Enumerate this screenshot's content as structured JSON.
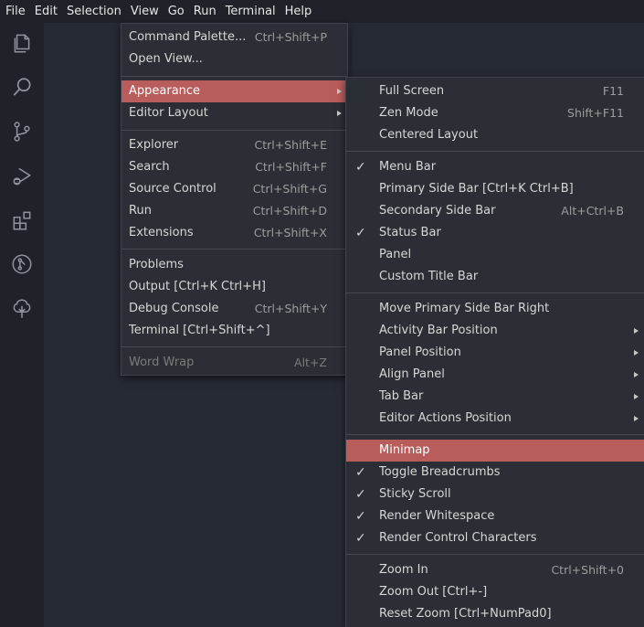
{
  "menubar": [
    "File",
    "Edit",
    "Selection",
    "View",
    "Go",
    "Run",
    "Terminal",
    "Help"
  ],
  "activity_icons": [
    "explorer-icon",
    "search-icon",
    "source-control-icon",
    "run-debug-icon",
    "extensions-icon",
    "remote-explorer-icon",
    "tree-icon"
  ],
  "view_menu": {
    "items": [
      {
        "label": "Command Palette...",
        "key": "Ctrl+Shift+P"
      },
      {
        "label": "Open View...",
        "key": ""
      },
      {
        "label": "Appearance",
        "key": "",
        "submenu": true,
        "selected": true
      },
      {
        "label": "Editor Layout",
        "key": "",
        "submenu": true
      },
      {
        "label": "Explorer",
        "key": "Ctrl+Shift+E"
      },
      {
        "label": "Search",
        "key": "Ctrl+Shift+F"
      },
      {
        "label": "Source Control",
        "key": "Ctrl+Shift+G"
      },
      {
        "label": "Run",
        "key": "Ctrl+Shift+D"
      },
      {
        "label": "Extensions",
        "key": "Ctrl+Shift+X"
      },
      {
        "label": "Problems",
        "key": ""
      },
      {
        "label": "Output [Ctrl+K Ctrl+H]",
        "key": ""
      },
      {
        "label": "Debug Console",
        "key": "Ctrl+Shift+Y"
      },
      {
        "label": "Terminal [Ctrl+Shift+^]",
        "key": ""
      },
      {
        "label": "Word Wrap",
        "key": "Alt+Z",
        "disabled": true
      }
    ]
  },
  "appearance_menu": {
    "items": [
      {
        "label": "Full Screen",
        "key": "F11"
      },
      {
        "label": "Zen Mode",
        "key": "Shift+F11"
      },
      {
        "label": "Centered Layout",
        "key": ""
      },
      {
        "label": "Menu Bar",
        "key": "",
        "checked": true
      },
      {
        "label": "Primary Side Bar [Ctrl+K Ctrl+B]",
        "key": ""
      },
      {
        "label": "Secondary Side Bar",
        "key": "Alt+Ctrl+B"
      },
      {
        "label": "Status Bar",
        "key": "",
        "checked": true
      },
      {
        "label": "Panel",
        "key": ""
      },
      {
        "label": "Custom Title Bar",
        "key": ""
      },
      {
        "label": "Move Primary Side Bar Right",
        "key": ""
      },
      {
        "label": "Activity Bar Position",
        "key": "",
        "submenu": true
      },
      {
        "label": "Panel Position",
        "key": "",
        "submenu": true
      },
      {
        "label": "Align Panel",
        "key": "",
        "submenu": true
      },
      {
        "label": "Tab Bar",
        "key": "",
        "submenu": true
      },
      {
        "label": "Editor Actions Position",
        "key": "",
        "submenu": true
      },
      {
        "label": "Minimap",
        "key": "",
        "selected": true
      },
      {
        "label": "Toggle Breadcrumbs",
        "key": "",
        "checked": true
      },
      {
        "label": "Sticky Scroll",
        "key": "",
        "checked": true
      },
      {
        "label": "Render Whitespace",
        "key": "",
        "checked": true
      },
      {
        "label": "Render Control Characters",
        "key": "",
        "checked": true
      },
      {
        "label": "Zoom In",
        "key": "Ctrl+Shift+0"
      },
      {
        "label": "Zoom Out [Ctrl+-]",
        "key": ""
      },
      {
        "label": "Reset Zoom [Ctrl+NumPad0]",
        "key": ""
      }
    ]
  },
  "colors": {
    "selected_bg": "#b85c5c",
    "menu_bg": "#2b2e35",
    "bar_bg": "#1f2229",
    "editor_bg": "#262a33"
  }
}
